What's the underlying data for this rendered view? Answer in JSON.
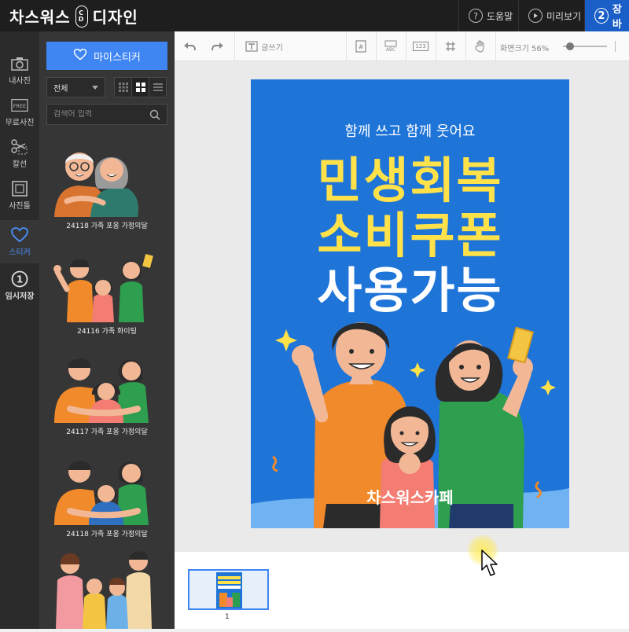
{
  "app": {
    "logo_left": "차스워스",
    "logo_badge_top": "C",
    "logo_badge_bottom": "D",
    "logo_right": "디자인"
  },
  "topbar": {
    "help_label": "도움말",
    "preview_label": "미리보기",
    "save_step": "2",
    "save_label": "장바"
  },
  "leftnav": {
    "items": [
      {
        "label": "내사진"
      },
      {
        "label": "무료사진"
      },
      {
        "label": "칼선"
      },
      {
        "label": "사진틀"
      },
      {
        "label": "스티커"
      },
      {
        "label": "임시저장"
      }
    ],
    "free_tag": "FREE",
    "temp_number": "1"
  },
  "panel": {
    "my_sticker_label": "마이스티커",
    "category_selected": "전체",
    "search_placeholder": "검색어 입력",
    "stickers": [
      {
        "caption": "24118 가족 포옹 가정의달"
      },
      {
        "caption": "24116 가족 화이팅"
      },
      {
        "caption": "24117 가족 포옹 가정의달"
      },
      {
        "caption": "24118 가족 포옹 가정의달"
      },
      {
        "caption": ""
      }
    ]
  },
  "toolbar": {
    "text_label": "글쓰기",
    "zoom_label": "화면크기",
    "zoom_value": "56%",
    "barcode_label": "ABC",
    "number_label": "123"
  },
  "design": {
    "subtitle": "함께 쓰고 함께 웃어요",
    "line1": "민생회복",
    "line2": "소비쿠폰",
    "line3": "사용가능",
    "brand": "차스워스카페"
  },
  "pages": {
    "thumb_number": "1"
  },
  "colors": {
    "accent": "#3f86f2",
    "poster_bg": "#1f74d8",
    "headline_yellow": "#ffe24a",
    "save_button": "#1a5fc7"
  }
}
